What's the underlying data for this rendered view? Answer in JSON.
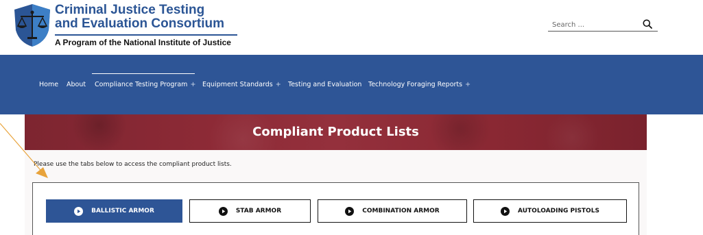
{
  "header": {
    "logo": {
      "title_line1": "Criminal Justice Testing",
      "title_line2": "and Evaluation Consortium",
      "tagline": "A Program of the National Institute of Justice"
    },
    "search": {
      "placeholder": "Search ...",
      "icon": "search-icon"
    }
  },
  "nav": {
    "items": [
      {
        "label": "Home",
        "has_submenu": false
      },
      {
        "label": "About",
        "has_submenu": false
      },
      {
        "label": "Compliance Testing Program",
        "has_submenu": true,
        "active": true
      },
      {
        "label": "Equipment Standards",
        "has_submenu": true
      },
      {
        "label": "Testing and Evaluation",
        "has_submenu": false
      },
      {
        "label": "Technology Foraging Reports",
        "has_submenu": true
      }
    ],
    "submenu_indicator": "+"
  },
  "page": {
    "banner_title": "Compliant Product Lists",
    "intro": "Please use the tabs below to access the compliant product lists.",
    "tabs": [
      {
        "label": "BALLISTIC ARMOR",
        "active": true,
        "icon": "play-circle-icon"
      },
      {
        "label": "STAB ARMOR",
        "active": false,
        "icon": "play-circle-icon"
      },
      {
        "label": "COMBINATION ARMOR",
        "active": false,
        "icon": "play-circle-icon"
      },
      {
        "label": "AUTOLOADING PISTOLS",
        "active": false,
        "icon": "play-circle-icon"
      }
    ]
  },
  "colors": {
    "brand_blue": "#2e5596",
    "banner_red": "#8a2833",
    "annotation_orange": "#e8a33b"
  }
}
